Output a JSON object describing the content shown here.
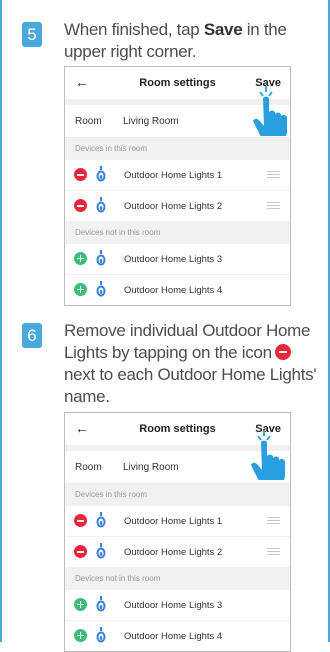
{
  "steps": [
    {
      "number": "5",
      "instruction_pre": "When finished, tap ",
      "instruction_bold": "Save",
      "instruction_post": " in the upper right corner.",
      "screen": {
        "back_icon": "←",
        "title": "Room settings",
        "save_label": "Save",
        "room_label": "Room",
        "room_value": "Living Room",
        "section_in": "Devices in this room",
        "devices_in": [
          "Outdoor Home Lights 1",
          "Outdoor Home Lights 2"
        ],
        "section_out": "Devices not in this room",
        "devices_out": [
          "Outdoor Home Lights 3",
          "Outdoor Home Lights 4"
        ]
      }
    },
    {
      "number": "6",
      "instruction_pre": "Remove individual Outdoor Home Lights by tapping on the icon",
      "instruction_post": "next to each Outdoor Home Lights' name.",
      "screen": {
        "back_icon": "←",
        "title": "Room settings",
        "save_label": "Save",
        "room_label": "Room",
        "room_value": "Living Room",
        "section_in": "Devices in this room",
        "devices_in": [
          "Outdoor Home Lights 1",
          "Outdoor Home Lights 2"
        ],
        "section_out": "Devices not in this room",
        "devices_out": [
          "Outdoor Home Lights 3",
          "Outdoor Home Lights 4"
        ]
      }
    }
  ],
  "icons": {
    "remove": "minus-circle-icon",
    "add": "plus-circle-icon",
    "device": "bulb-icon",
    "drag": "drag-handle-icon",
    "pointer": "tap-hand-icon"
  },
  "colors": {
    "accent": "#4aa8dd",
    "remove": "#e8283a",
    "add": "#3dbb7a",
    "device_icon": "#3b7fd6"
  }
}
